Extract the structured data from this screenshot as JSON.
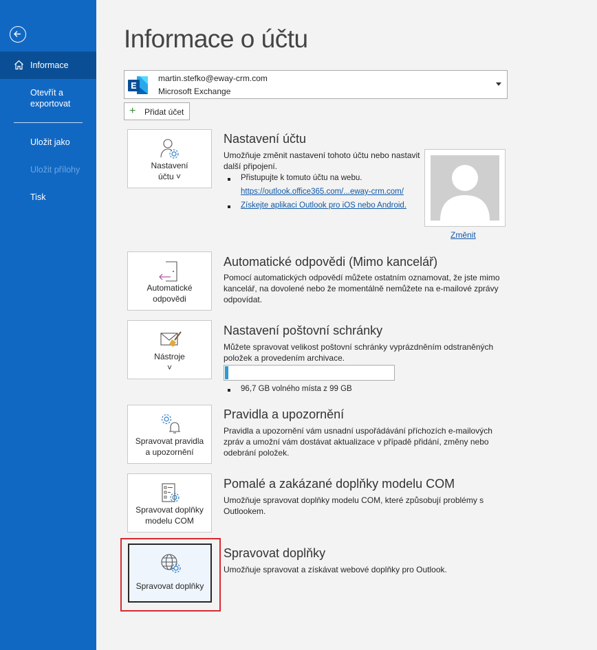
{
  "sidebar": {
    "items": [
      {
        "label": "Informace",
        "active": true
      },
      {
        "label": "Otevřít a exportovat"
      },
      {
        "label": "Uložit jako"
      },
      {
        "label": "Uložit přílohy",
        "disabled": true
      },
      {
        "label": "Tisk"
      }
    ]
  },
  "page": {
    "title": "Informace o účtu"
  },
  "account": {
    "email": "martin.stefko@eway-crm.com",
    "type": "Microsoft Exchange",
    "add_label": "Přidat účet"
  },
  "sections": {
    "account_settings": {
      "tile_line1": "Nastavení",
      "tile_line2": "účtu ˅",
      "title": "Nastavení účtu",
      "desc": "Umožňuje změnit nastavení tohoto účtu nebo nastavit další připojení.",
      "bullet1": "Přistupujte k tomuto účtu na webu.",
      "bullet1_link": "https://outlook.office365.com/...eway-crm.com/",
      "bullet2_link": "Získejte aplikaci Outlook pro iOS nebo Android.",
      "change_label": "Změnit"
    },
    "auto_reply": {
      "tile_line1": "Automatické",
      "tile_line2": "odpovědi",
      "title": "Automatické odpovědi (Mimo kancelář)",
      "desc": "Pomocí automatických odpovědí můžete ostatním oznamovat, že jste mimo kancelář, na dovolené nebo že momentálně nemůžete na e-mailové zprávy odpovídat."
    },
    "mailbox": {
      "tile_line1": "Nástroje",
      "tile_line2": "˅",
      "title": "Nastavení poštovní schránky",
      "desc": "Můžete spravovat velikost poštovní schránky vyprázdněním odstraněných položek a provedením archivace.",
      "quota_used_fraction": 0.02,
      "quota_text": "96,7 GB volného místa z 99 GB"
    },
    "rules": {
      "tile_line1": "Spravovat pravidla",
      "tile_line2": "a upozornění",
      "title": "Pravidla a upozornění",
      "desc": "Pravidla a upozornění vám usnadní uspořádávání příchozích e-mailových zpráv a umožní vám dostávat aktualizace v případě přidání, změny nebo odebrání položek."
    },
    "com": {
      "tile_line1": "Spravovat doplňky",
      "tile_line2": "modelu COM",
      "title": "Pomalé a zakázané doplňky modelu COM",
      "desc": "Umožňuje spravovat doplňky modelu COM, které způsobují problémy s Outlookem."
    },
    "addins": {
      "tile_line1": "Spravovat doplňky",
      "title": "Spravovat doplňky",
      "desc": "Umožňuje spravovat a získávat webové doplňky pro Outlook."
    }
  }
}
